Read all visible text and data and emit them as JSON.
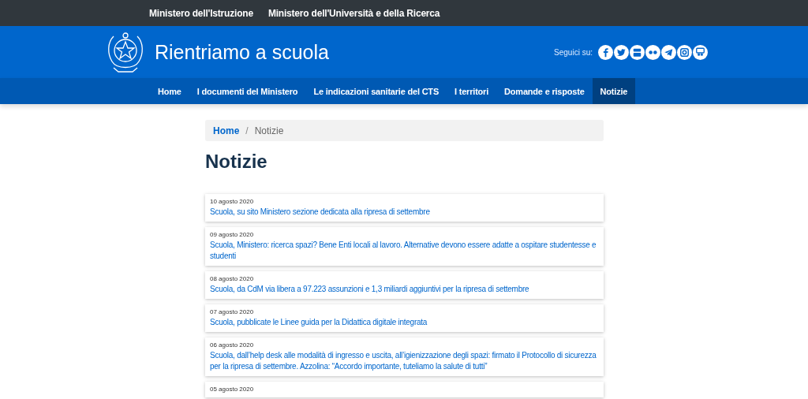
{
  "top_bar": {
    "links": [
      "Ministero dell'Istruzione",
      "Ministero dell'Università e della Ricerca"
    ]
  },
  "header": {
    "title": "Rientriamo a scuola",
    "follow_label": "Seguici su:",
    "social_links": [
      {
        "kind": "facebook"
      },
      {
        "kind": "twitter"
      },
      {
        "kind": "youtube"
      },
      {
        "kind": "flickr"
      },
      {
        "kind": "telegram"
      },
      {
        "kind": "instagram"
      },
      {
        "kind": "slideshare"
      }
    ]
  },
  "nav": [
    {
      "label": "Home",
      "selected": false
    },
    {
      "label": "I documenti del Ministero",
      "selected": false
    },
    {
      "label": "Le indicazioni sanitarie del CTS",
      "selected": false
    },
    {
      "label": "I territori",
      "selected": false
    },
    {
      "label": "Domande e risposte",
      "selected": false
    },
    {
      "label": "Notizie",
      "selected": true
    }
  ],
  "breadcrumb": {
    "link": "Home",
    "separator": "/",
    "current": "Notizie"
  },
  "page_title": "Notizie",
  "news": [
    {
      "date": "10 agosto 2020",
      "title": "Scuola, su sito Ministero sezione dedicata alla ripresa di settembre"
    },
    {
      "date": "09 agosto 2020",
      "title": "Scuola, Ministero: ricerca spazi? Bene Enti locali al lavoro. Alternative devono essere adatte a ospitare studentesse e studenti"
    },
    {
      "date": "08 agosto 2020",
      "title": "Scuola, da CdM via libera a 97.223 assunzioni e 1,3 miliardi aggiuntivi per la ripresa di settembre"
    },
    {
      "date": "07 agosto 2020",
      "title": "Scuola, pubblicate le Linee guida per la Didattica digitale integrata"
    },
    {
      "date": "06 agosto 2020",
      "title": "Scuola, dall’help desk alle modalità di ingresso e uscita, all’igienizzazione degli spazi: firmato il Protocollo di sicurezza per la ripresa di settembre. Azzolina: “Accordo importante, tuteliamo la salute di tutti”"
    },
    {
      "date": "05 agosto 2020"
    }
  ]
}
